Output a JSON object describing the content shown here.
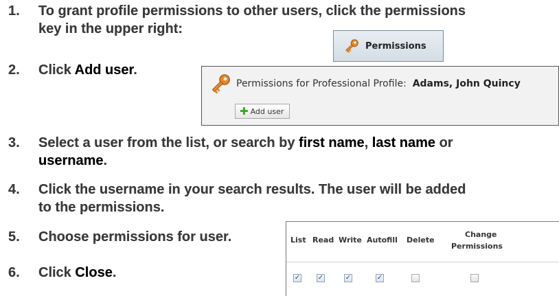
{
  "steps": [
    {
      "num": "1.",
      "line1": "To grant profile permissions to other users, click the permissions",
      "line2": "key in the upper right:"
    },
    {
      "num": "2.",
      "pre": "Click ",
      "em": "Add user",
      "post": "."
    },
    {
      "num": "3.",
      "pre": "Select a user from the list, or search by ",
      "em1": "first name",
      "mid1": ", ",
      "em2": "last name",
      "mid2": " or",
      "em3": "username",
      "post": "."
    },
    {
      "num": "4.",
      "line1": "Click the username in your search results. The user will be added",
      "line2": "to the permissions."
    },
    {
      "num": "5.",
      "text": "Choose permissions for user."
    },
    {
      "num": "6.",
      "pre": "Click ",
      "em": "Close",
      "post": "."
    }
  ],
  "permissions_button": {
    "label": "Permissions",
    "icon": "key-icon"
  },
  "panel": {
    "title": "Permissions for Professional Profile:",
    "profile_name": "Adams, John Quincy",
    "add_user_label": "Add user",
    "icon": "key-icon"
  },
  "permissions_table": {
    "columns": [
      "List",
      "Read",
      "Write",
      "Autofill",
      "Delete",
      "Change",
      "Permissions"
    ],
    "checked": [
      true,
      true,
      true,
      true,
      false,
      false
    ]
  },
  "colors": {
    "text": "#3a3a3a",
    "key_orange": "#e88a2a",
    "plus_green": "#3aa526"
  }
}
